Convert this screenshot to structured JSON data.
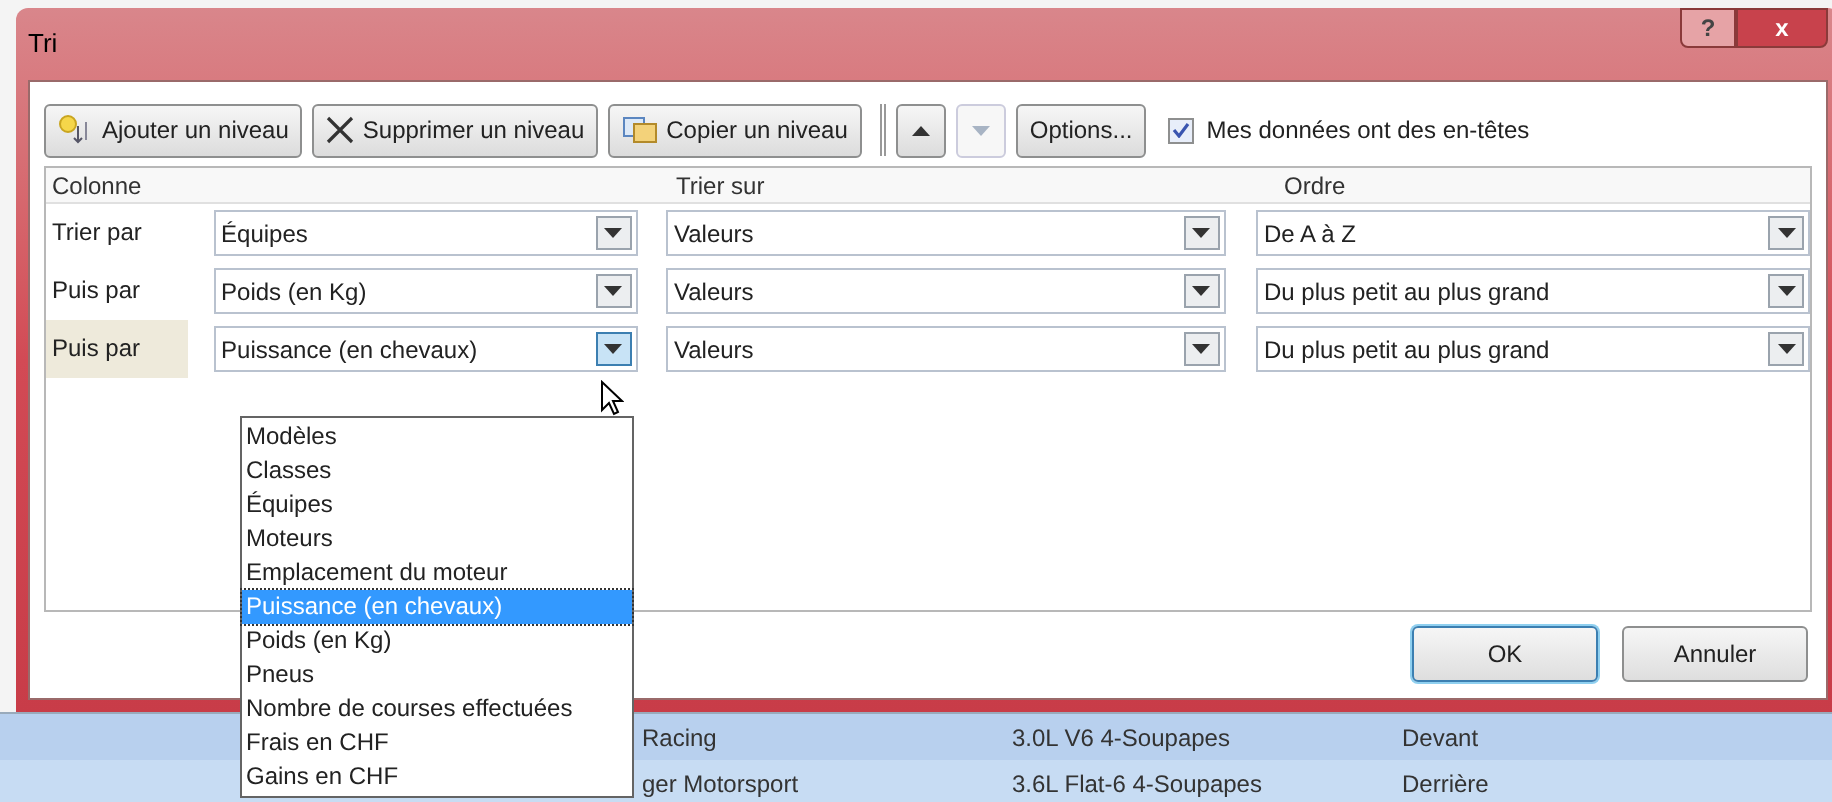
{
  "window": {
    "title": "Tri",
    "title_buttons": [
      {
        "kind": "help",
        "label": "?"
      },
      {
        "kind": "close",
        "label": "x"
      }
    ]
  },
  "toolbar": [
    {
      "kind": "add",
      "label": "Ajouter un niveau",
      "disabled": false
    },
    {
      "kind": "delete",
      "label": "Supprimer un niveau",
      "disabled": false
    },
    {
      "kind": "copy",
      "label": "Copier un niveau",
      "disabled": false
    },
    {
      "kind": "up",
      "disabled": false
    },
    {
      "kind": "down",
      "disabled": true
    },
    {
      "kind": "text",
      "label": "Options...",
      "disabled": false
    }
  ],
  "headers_checkbox": {
    "label": "Mes données ont des en-têtes",
    "checked": true
  },
  "grid": {
    "columns": [
      "Colonne",
      "Trier sur",
      "Ordre"
    ],
    "rows": [
      {
        "label": "Trier par",
        "column": "Équipes",
        "sort_on": "Valeurs",
        "order": "De A à Z",
        "selected": false
      },
      {
        "label": "Puis par",
        "column": "Poids (en Kg)",
        "sort_on": "Valeurs",
        "order": "Du plus petit au plus grand",
        "selected": false
      },
      {
        "label": "Puis par",
        "column": "Puissance  (en chevaux)",
        "sort_on": "Valeurs",
        "order": "Du plus petit au plus grand",
        "selected": true
      }
    ]
  },
  "dropdown": {
    "items": [
      {
        "label": "Modèles",
        "selected": false
      },
      {
        "label": "Classes",
        "selected": false
      },
      {
        "label": "Équipes",
        "selected": false
      },
      {
        "label": "Moteurs",
        "selected": false
      },
      {
        "label": "Emplacement du moteur",
        "selected": false
      },
      {
        "label": "Puissance  (en chevaux)",
        "selected": true
      },
      {
        "label": "Poids (en Kg)",
        "selected": false
      },
      {
        "label": "Pneus",
        "selected": false
      },
      {
        "label": "Nombre de  courses effectuées",
        "selected": false
      },
      {
        "label": "Frais en CHF",
        "selected": false
      },
      {
        "label": "Gains en CHF",
        "selected": false
      }
    ]
  },
  "footer_buttons": [
    {
      "label": "OK",
      "default": true
    },
    {
      "label": "Annuler",
      "default": false
    }
  ],
  "sheet_rows": [
    [
      "Racing",
      "3.0L V6 4-Soupapes",
      "Devant"
    ],
    [
      "ger Motorsport",
      "3.6L Flat-6 4-Soupapes",
      "Derrière"
    ]
  ]
}
